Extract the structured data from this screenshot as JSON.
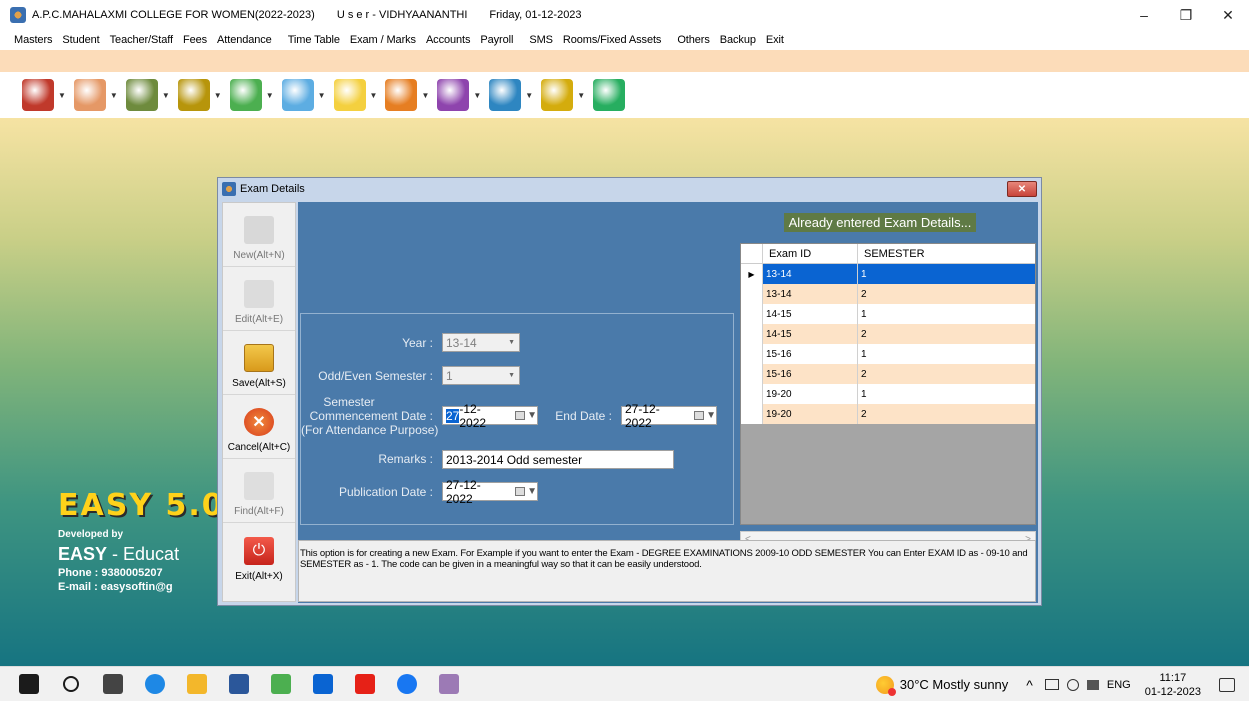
{
  "titlebar": {
    "college": "A.P.C.MAHALAXMI COLLEGE FOR WOMEN(2022-2023)",
    "user": "U s e r - VIDHYAANANTHI",
    "date": "Friday, 01-12-2023",
    "minimize": "–",
    "maximize": "❐",
    "close": "✕"
  },
  "menu": [
    "Masters",
    "Student",
    "Teacher/Staff",
    "Fees",
    "Attendance",
    "Time Table",
    "Exam / Marks",
    "Accounts",
    "Payroll",
    "SMS",
    "Rooms/Fixed Assets",
    "Others",
    "Backup",
    "Exit"
  ],
  "toolbar_icons": [
    {
      "name": "gift-icon",
      "color": "#c0392b"
    },
    {
      "name": "users-icon",
      "color": "#e59866"
    },
    {
      "name": "group-icon",
      "color": "#6e8b3d"
    },
    {
      "name": "coins-icon",
      "color": "#b7950b"
    },
    {
      "name": "clock-icon",
      "color": "#4caf50"
    },
    {
      "name": "calendar-icon",
      "color": "#5dade2"
    },
    {
      "name": "notepad-icon",
      "color": "#f4d03f"
    },
    {
      "name": "books-icon",
      "color": "#e67e22"
    },
    {
      "name": "person-settings-icon",
      "color": "#8e44ad"
    },
    {
      "name": "chart-icon",
      "color": "#2e86c1"
    },
    {
      "name": "gears-icon",
      "color": "#d4ac0d"
    },
    {
      "name": "exit-door-icon",
      "color": "#27ae60"
    }
  ],
  "toolbar_arrow": "▼",
  "brand": {
    "logo": "EASY 5.0",
    "developed_by": "Developed by",
    "easy": "EASY",
    "easy_rest": " - Educat",
    "phone": "Phone : 9380005207",
    "email": "E-mail : easysoftin@g"
  },
  "dialog": {
    "title": "Exam Details",
    "close": "✕",
    "buttons": {
      "new": "New(Alt+N)",
      "edit": "Edit(Alt+E)",
      "save": "Save(Alt+S)",
      "cancel": "Cancel(Alt+C)",
      "find": "Find(Alt+F)",
      "exit": "Exit(Alt+X)"
    },
    "already_label": "Already entered Exam Details...",
    "grid": {
      "columns": [
        "Exam ID",
        "SEMESTER"
      ],
      "row_marker": "▶",
      "rows": [
        [
          "13-14",
          "1"
        ],
        [
          "13-14",
          "2"
        ],
        [
          "14-15",
          "1"
        ],
        [
          "14-15",
          "2"
        ],
        [
          "15-16",
          "1"
        ],
        [
          "15-16",
          "2"
        ],
        [
          "19-20",
          "1"
        ],
        [
          "19-20",
          "2"
        ]
      ],
      "scroll_left": "<",
      "scroll_right": ">"
    },
    "form": {
      "year_label": "Year :",
      "year_value": "13-14",
      "sem_label": "Odd/Even Semester :",
      "sem_value": "1",
      "comm_label_1": "Semester",
      "comm_label_2": "Commencement  Date :",
      "comm_label_3": "(For Attendance Purpose)",
      "comm_value_hl": "27",
      "comm_value_rest": "-12-2022",
      "end_label": "End  Date :",
      "end_value": "27-12-2022",
      "remarks_label": "Remarks :",
      "remarks_value": "2013-2014  Odd semester",
      "pub_label": "Publication Date :",
      "pub_value": "27-12-2022",
      "dropdown_arrow": "▼"
    },
    "info": "This option is for creating a new Exam. For Example if you want to enter the Exam - DEGREE EXAMINATIONS 2009-10 ODD SEMESTER You can Enter EXAM ID as - 09-10 and SEMESTER as - 1. The code can be given in a meaningful way so that it can be easily understood."
  },
  "taskbar": {
    "apps": [
      {
        "name": "windows-start-icon",
        "color": "#1b1b1b"
      },
      {
        "name": "search-icon",
        "color": "#1b1b1b"
      },
      {
        "name": "task-view-icon",
        "color": "#444444"
      },
      {
        "name": "edge-icon",
        "color": "#1e88e5"
      },
      {
        "name": "file-explorer-icon",
        "color": "#f3b72b"
      },
      {
        "name": "word-icon",
        "color": "#2b579a"
      },
      {
        "name": "paint-icon",
        "color": "#4caf50"
      },
      {
        "name": "mail-icon",
        "color": "#0a64d2"
      },
      {
        "name": "youtube-icon",
        "color": "#e62117"
      },
      {
        "name": "facebook-icon",
        "color": "#1877f2"
      },
      {
        "name": "easy-app-icon",
        "color": "#9c7ab5"
      }
    ],
    "weather": "30°C  Mostly sunny",
    "tray_symbols": "^",
    "lang": "ENG",
    "time": "11:17",
    "date": "01-12-2023"
  }
}
